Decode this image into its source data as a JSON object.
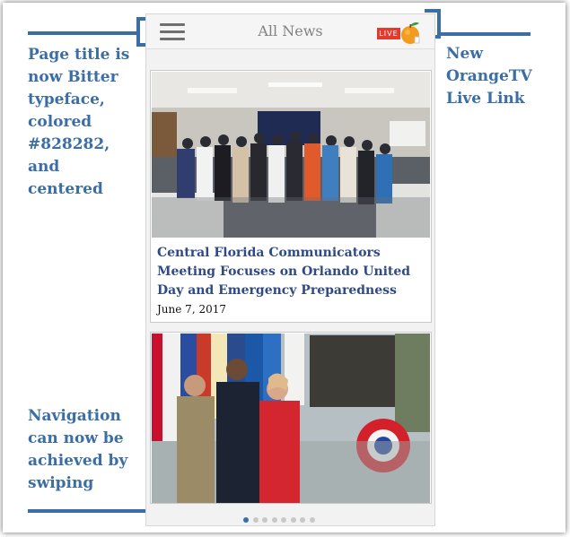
{
  "callouts": {
    "title_note": "Page title is now Bitter typeface, colored #828282, and centered",
    "live_note": "New OrangeTV Live Link",
    "nav_note": "Navigation can now be achieved by swiping"
  },
  "header": {
    "title": "All News",
    "title_color": "#828282",
    "live_badge": "LIVE",
    "menu_icon": "hamburger-icon",
    "live_icon": "orange-icon"
  },
  "articles": [
    {
      "headline": "Central Florida Communicators Meeting Focuses on  Orlando United Day and Emergency Preparedness",
      "date": "June 7, 2017"
    },
    {
      "headline": "",
      "date": ""
    }
  ],
  "pager": {
    "total": 8,
    "active": 1
  },
  "colors": {
    "accent": "#3a6ea5",
    "headline": "#2f4a86",
    "live_badge": "#e23b2e"
  }
}
